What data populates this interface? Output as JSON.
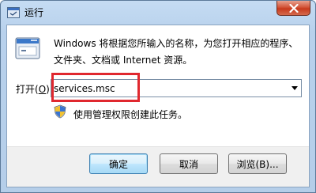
{
  "window": {
    "title": "运行",
    "close_icon": "close-icon",
    "accent_close": "#c7391c"
  },
  "dialog": {
    "description": "Windows 将根据您所输入的名称，为您打开相应的程序、文件夹、文档或 Internet 资源。",
    "open_label_prefix": "打开(",
    "open_label_hotkey": "O",
    "open_label_suffix": "):",
    "input_value": "services.msc",
    "admin_note": "使用管理权限创建此任务。",
    "highlight_color": "#e0282f"
  },
  "buttons": {
    "ok": "确定",
    "cancel": "取消",
    "browse": "浏览(B)..."
  }
}
